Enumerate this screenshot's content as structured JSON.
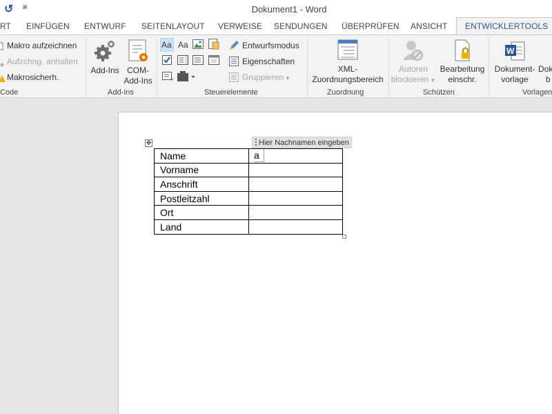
{
  "titlebar": {
    "title": "Dokument1 - Word",
    "undo_icon": "undo-icon",
    "qat_icon": "customize-qat-icon",
    "qat_glyph": "≆"
  },
  "tabs": [
    {
      "label": "RT"
    },
    {
      "label": "EINFÜGEN"
    },
    {
      "label": "ENTWURF"
    },
    {
      "label": "SEITENLAYOUT"
    },
    {
      "label": "VERWEISE"
    },
    {
      "label": "SENDUNGEN"
    },
    {
      "label": "ÜBERPRÜFEN"
    },
    {
      "label": "ANSICHT"
    },
    {
      "label": "ENTWICKLERTOOLS",
      "active": true
    }
  ],
  "ribbon": {
    "code": {
      "record_macro": "Makro aufzeichnen",
      "pause_recording": "Aufzchng. anhalten",
      "macro_security": "Makrosicherh.",
      "group_label": "Code"
    },
    "addins": {
      "addins_label": "Add-Ins",
      "com_addins_line1": "COM-",
      "com_addins_line2": "Add-Ins",
      "group_label": "Add-Ins"
    },
    "controls": {
      "design_mode": "Entwurfsmodus",
      "properties": "Eigenschaften",
      "group": "Gruppieren",
      "group_label": "Steuerelemente"
    },
    "mapping": {
      "xml_line1": "XML-",
      "xml_line2": "Zuordnungsbereich",
      "group_label": "Zuordnung"
    },
    "protect": {
      "block_authors_line1": "Autoren",
      "block_authors_line2": "blockieren",
      "restrict_editing_line1": "Bearbeitung",
      "restrict_editing_line2": "einschr.",
      "group_label": "Schützen"
    },
    "templates": {
      "doc_template_line1": "Dokument-",
      "doc_template_line2": "vorlage",
      "doc_panel_line1": "Doku",
      "doc_panel_line2": "b",
      "group_label": "Vorlagen"
    },
    "accent_color": "#2b579a"
  },
  "document": {
    "content_control_tag": "Hier Nachnamen eingeben",
    "content_control_value": "a",
    "table": {
      "rows": [
        {
          "label": "Name",
          "value": ""
        },
        {
          "label": "Vorname",
          "value": ""
        },
        {
          "label": "Anschrift",
          "value": ""
        },
        {
          "label": "Postleitzahl",
          "value": ""
        },
        {
          "label": "Ort",
          "value": ""
        },
        {
          "label": "Land",
          "value": ""
        }
      ]
    }
  }
}
